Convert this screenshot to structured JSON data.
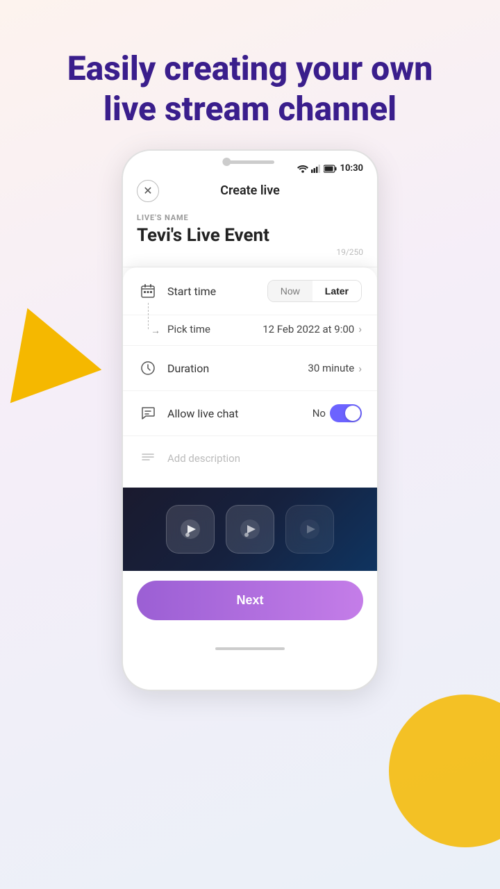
{
  "hero": {
    "title_line1": "Easily creating your own",
    "title_line2": "live stream channel"
  },
  "statusBar": {
    "time": "10:30"
  },
  "header": {
    "title": "Create live",
    "close_label": "×"
  },
  "liveForm": {
    "name_label": "LIVE'S NAME",
    "name_value": "Tevi's Live Event",
    "char_count": "19/250"
  },
  "settings": {
    "start_time_label": "Start time",
    "btn_now": "Now",
    "btn_later": "Later",
    "pick_time_label": "Pick time",
    "pick_time_value": "12 Feb 2022 at 9:00",
    "duration_label": "Duration",
    "duration_value": "30 minute",
    "allow_chat_label": "Allow live chat",
    "allow_chat_status": "No",
    "add_description_placeholder": "Add description"
  },
  "nextButton": {
    "label": "Next"
  }
}
